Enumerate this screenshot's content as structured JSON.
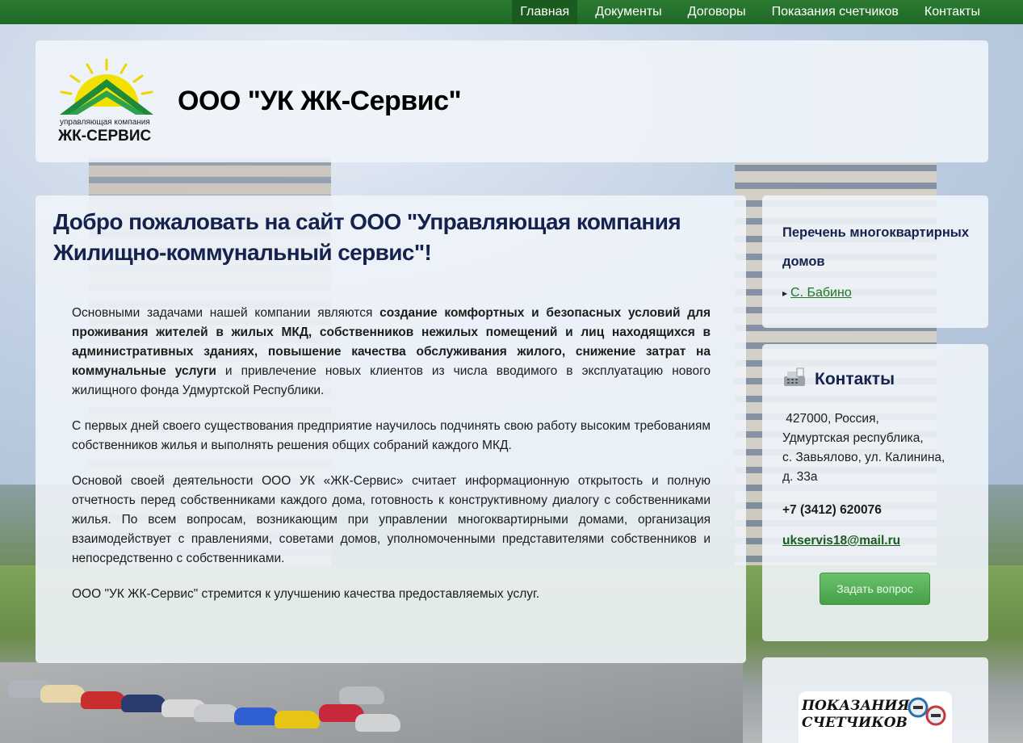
{
  "nav": {
    "items": [
      {
        "label": "Главная",
        "active": true
      },
      {
        "label": "Документы"
      },
      {
        "label": "Договоры"
      },
      {
        "label": "Показания счетчиков"
      },
      {
        "label": "Контакты"
      }
    ]
  },
  "header": {
    "logo_line1": "управляющая компания",
    "logo_line2": "ЖК-СЕРВИС",
    "title": "ООО \"УК ЖК-Сервис\""
  },
  "main": {
    "heading": "Добро пожаловать на сайт ООО \"Управляющая компания Жилищно-коммунальный сервис\"!",
    "p1_start": "Основными задачами нашей компании являются ",
    "p1_bold": "создание комфортных и безопасных условий для проживания жителей в жилых МКД, собственников нежилых помещений и лиц находящихся в административных зданиях, повышение качества обслуживания жилого, снижение затрат на коммунальные услуги",
    "p1_end": " и привлечение новых клиентов из числа вводимого в эксплуатацию нового жилищного фонда Удмуртской Республики.",
    "p2": "С первых дней своего существования предприятие научилось подчинять свою работу высоким требованиям собственников жилья и выполнять решения общих собраний каждого МКД.",
    "p3": "Основой своей деятельности ООО УК «ЖК-Сервис» считает информационную открытость и полную отчетность перед собственниками каждого дома, готовность к конструктивному диалогу с собственниками жилья. По всем вопросам, возникающим при управлении многоквартирными домами, организация взаимодействует с правлениями, советами домов, уполномоченными представителями собственников и непосредственно с собственниками.",
    "p4": "ООО \"УК ЖК-Сервис\" стремится к улучшению качества предоставляемых услуг."
  },
  "sidebar": {
    "houses_heading": "Перечень многоквартирных домов",
    "houses": [
      "С. Бабино"
    ],
    "contacts_heading": "Контакты",
    "address_line1": " 427000, Россия,",
    "address_line2": "Удмуртская республика,",
    "address_line3": "с. Завьялово, ул. Калинина,",
    "address_line4": "д. 33а",
    "phone": "+7 (3412) 620076",
    "email": "ukservis18@mail.ru",
    "ask_button": "Задать вопрос",
    "meters_banner_line1": "ПОКАЗАНИЯ",
    "meters_banner_line2": "СЧЕТЧИКОВ"
  },
  "colors": {
    "nav_bg": "#1e6a25",
    "heading": "#15224e",
    "link": "#1a7a22",
    "button": "#45a047"
  }
}
